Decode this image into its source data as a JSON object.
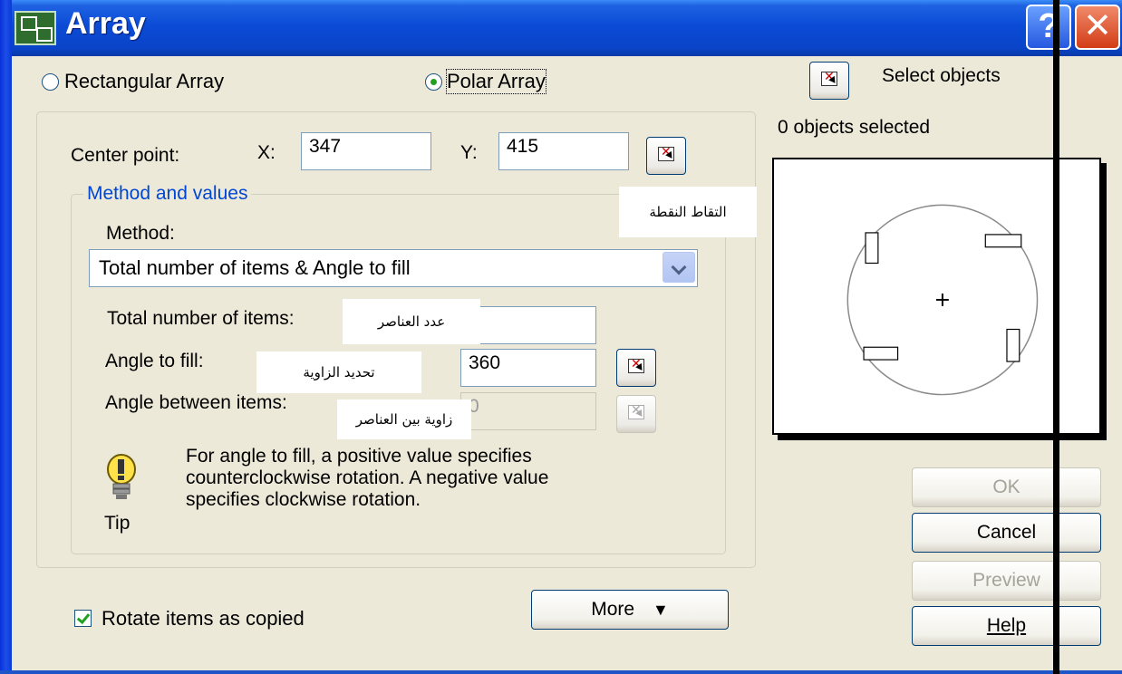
{
  "window": {
    "title": "Array"
  },
  "radios": {
    "rectangular": "Rectangular Array",
    "polar": "Polar Array"
  },
  "select_objects": {
    "label": "Select objects",
    "status": "0 objects selected"
  },
  "center_point": {
    "label": "Center point:",
    "x_label": "X:",
    "x_value": "347",
    "y_label": "Y:",
    "y_value": "415"
  },
  "method_group": {
    "title": "Method and values",
    "method_label": "Method:",
    "method_value": "Total number of items & Angle to fill",
    "total_items_label": "Total number of items:",
    "total_items_value": "",
    "angle_fill_label": "Angle to fill:",
    "angle_fill_value": "360",
    "angle_between_label": "Angle between items:",
    "angle_between_value": "0"
  },
  "annotations": {
    "pick_point": "التقاط النقطة",
    "total_items": "عدد العناصر",
    "angle_fill": "تحديد الزاوية",
    "angle_between": "زاوية بين العناصر"
  },
  "tip": {
    "text_lines": [
      "For angle to fill, a positive value specifies",
      "counterclockwise rotation.  A negative value",
      "specifies clockwise rotation."
    ],
    "label": "Tip"
  },
  "rotate_checkbox": {
    "label": "Rotate items as copied",
    "checked": true
  },
  "buttons": {
    "more": "More",
    "ok": "OK",
    "cancel": "Cancel",
    "preview": "Preview",
    "help": "Help"
  }
}
